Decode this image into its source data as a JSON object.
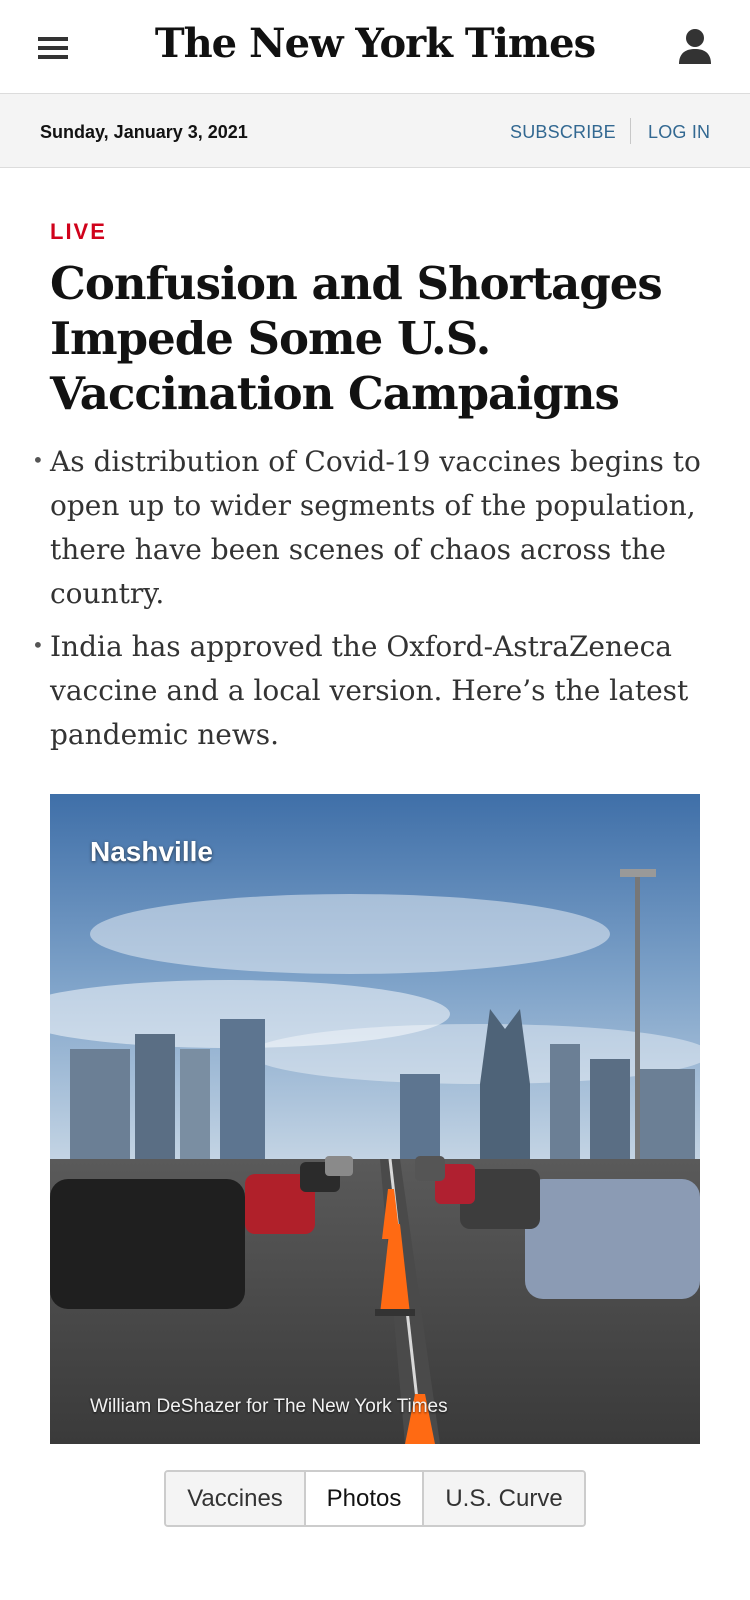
{
  "header": {
    "logo": "The New York Times",
    "menu_icon": "hamburger-menu-icon",
    "account_icon": "user-account-icon"
  },
  "datebar": {
    "date": "Sunday, January 3, 2021",
    "subscribe": "SUBSCRIBE",
    "login": "LOG IN"
  },
  "story": {
    "label": "LIVE",
    "headline": "Confusion and Shortages Impede Some U.S. Vaccination Campaigns",
    "bullets": [
      "As distribution of Covid-19 vaccines begins to open up to wider segments of the population, there have been scenes of chaos across the country.",
      "India has approved the Oxford-AstraZeneca vaccine and a local version. Here’s the latest pandemic news."
    ],
    "photo": {
      "location": "Nashville",
      "credit": "William DeShazer for The New York Times"
    }
  },
  "tabs": [
    {
      "label": "Vaccines",
      "active": false
    },
    {
      "label": "Photos",
      "active": true
    },
    {
      "label": "U.S. Curve",
      "active": false
    }
  ],
  "colors": {
    "live": "#d0021b",
    "link": "#326891",
    "bar_bg": "#f4f4f4"
  }
}
